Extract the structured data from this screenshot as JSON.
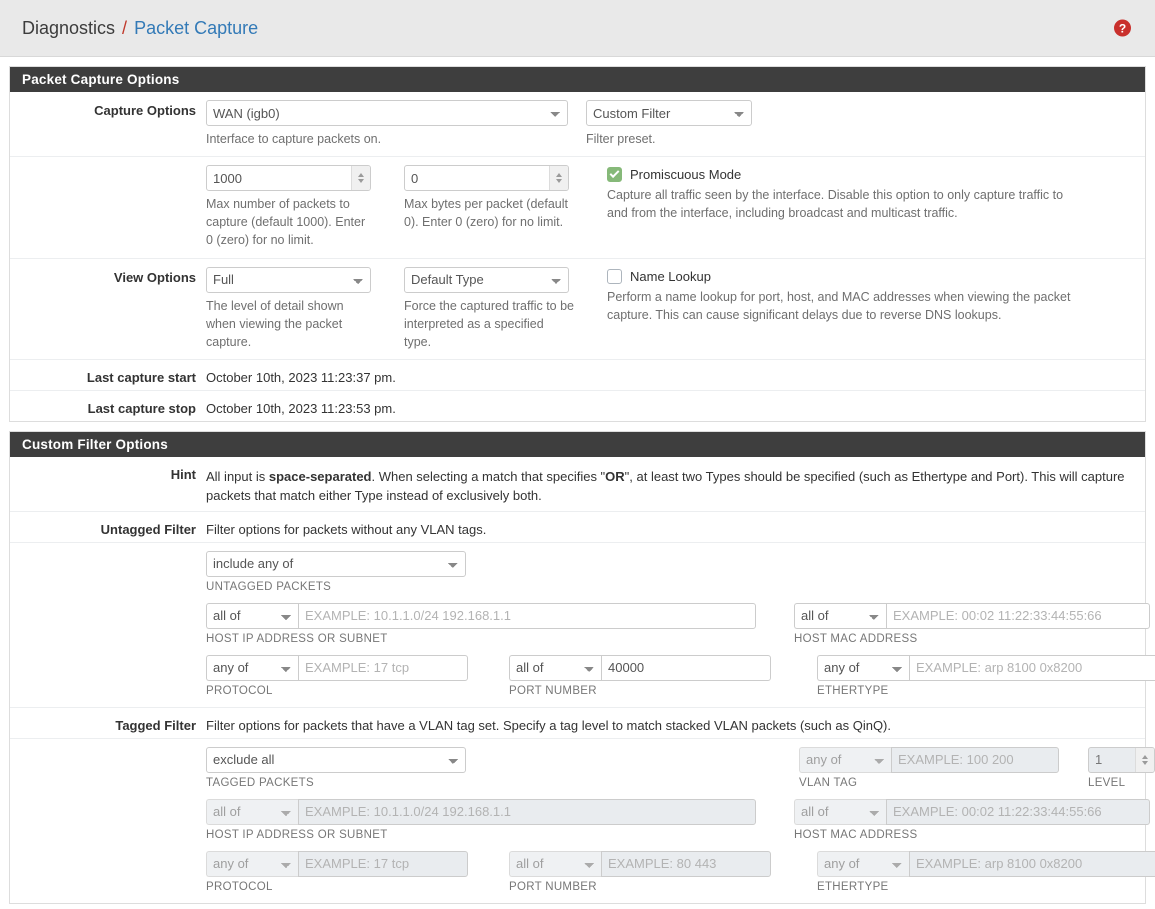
{
  "breadcrumb": {
    "parent": "Diagnostics",
    "separator": "/",
    "current": "Packet Capture",
    "help_icon_label": "?"
  },
  "capture_panel": {
    "heading": "Packet Capture Options",
    "capture_options": {
      "label": "Capture Options",
      "interface_value": "WAN (igb0)",
      "interface_help": "Interface to capture packets on.",
      "preset_value": "Custom Filter",
      "preset_help": "Filter preset."
    },
    "limits": {
      "count_value": "1000",
      "count_help": "Max number of packets to capture (default 1000). Enter 0 (zero) for no limit.",
      "length_value": "0",
      "length_help": "Max bytes per packet (default 0). Enter 0 (zero) for no limit.",
      "promiscuous_label": "Promiscuous Mode",
      "promiscuous_checked": true,
      "promiscuous_help": "Capture all traffic seen by the interface. Disable this option to only capture traffic to and from the interface, including broadcast and multicast traffic."
    },
    "view_options": {
      "label": "View Options",
      "detail_value": "Full",
      "detail_help": "The level of detail shown when viewing the packet capture.",
      "type_value": "Default Type",
      "type_help": "Force the captured traffic to be interpreted as a specified type.",
      "name_lookup_label": "Name Lookup",
      "name_lookup_checked": false,
      "name_lookup_help": "Perform a name lookup for port, host, and MAC addresses when viewing the packet capture. This can cause significant delays due to reverse DNS lookups."
    },
    "last_start": {
      "label": "Last capture start",
      "value": "October 10th, 2023 11:23:37 pm."
    },
    "last_stop": {
      "label": "Last capture stop",
      "value": "October 10th, 2023 11:23:53 pm."
    }
  },
  "filter_panel": {
    "heading": "Custom Filter Options",
    "hint": {
      "label": "Hint",
      "part1": "All input is ",
      "bold1": "space-separated",
      "part2": ". When selecting a match that specifies \"",
      "bold2": "OR",
      "part3": "\", at least two Types should be specified (such as Ethertype and Port). This will capture packets that match either Type instead of exclusively both."
    },
    "untagged": {
      "label": "Untagged Filter",
      "description": "Filter options for packets without any VLAN tags.",
      "packets_mode": "include any of",
      "packets_caption": "UNTAGGED PACKETS",
      "host_ip_mode": "all of",
      "host_ip_placeholder": "EXAMPLE: 10.1.1.0/24 192.168.1.1",
      "host_ip_value": "",
      "host_ip_caption": "HOST IP ADDRESS OR SUBNET",
      "host_mac_mode": "all of",
      "host_mac_placeholder": "EXAMPLE: 00:02 11:22:33:44:55:66",
      "host_mac_value": "",
      "host_mac_caption": "HOST MAC ADDRESS",
      "protocol_mode": "any of",
      "protocol_placeholder": "EXAMPLE: 17 tcp",
      "protocol_value": "",
      "protocol_caption": "PROTOCOL",
      "port_mode": "all of",
      "port_placeholder": "",
      "port_value": "40000",
      "port_caption": "PORT NUMBER",
      "ethertype_mode": "any of",
      "ethertype_placeholder": "EXAMPLE: arp 8100 0x8200",
      "ethertype_value": "",
      "ethertype_caption": "ETHERTYPE"
    },
    "tagged": {
      "label": "Tagged Filter",
      "description": "Filter options for packets that have a VLAN tag set. Specify a tag level to match stacked VLAN packets (such as QinQ).",
      "packets_mode": "exclude all",
      "packets_caption": "TAGGED PACKETS",
      "vlan_tag_mode": "any of",
      "vlan_tag_placeholder": "EXAMPLE: 100 200",
      "vlan_tag_value": "",
      "vlan_tag_caption": "VLAN TAG",
      "level_value": "1",
      "level_caption": "LEVEL",
      "host_ip_mode": "all of",
      "host_ip_placeholder": "EXAMPLE: 10.1.1.0/24 192.168.1.1",
      "host_ip_value": "",
      "host_ip_caption": "HOST IP ADDRESS OR SUBNET",
      "host_mac_mode": "all of",
      "host_mac_placeholder": "EXAMPLE: 00:02 11:22:33:44:55:66",
      "host_mac_value": "",
      "host_mac_caption": "HOST MAC ADDRESS",
      "protocol_mode": "any of",
      "protocol_placeholder": "EXAMPLE: 17 tcp",
      "protocol_value": "",
      "protocol_caption": "PROTOCOL",
      "port_mode": "all of",
      "port_placeholder": "EXAMPLE: 80 443",
      "port_value": "",
      "port_caption": "PORT NUMBER",
      "ethertype_mode": "any of",
      "ethertype_placeholder": "EXAMPLE: arp 8100 0x8200",
      "ethertype_value": "",
      "ethertype_caption": "ETHERTYPE"
    }
  },
  "colors": {
    "panel_heading_bg": "#3e3e3e",
    "breadcrumb_link": "#337ab7",
    "breadcrumb_sep": "#c0392b",
    "help_icon_bg": "#c9302c",
    "checkbox_checked": "#86b979",
    "disabled_bg": "#e9ecef"
  }
}
